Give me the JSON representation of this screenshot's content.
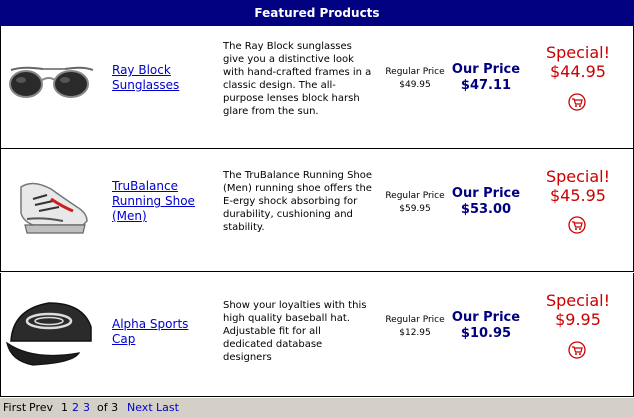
{
  "header": {
    "title": "Featured Products"
  },
  "products": [
    {
      "name": "Ray Block Sunglasses",
      "description": "The Ray Block sunglasses give you a distinctive look with hand-crafted frames in a classic design. The all-purpose lenses block harsh glare from the sun.",
      "regular_label": "Regular Price",
      "regular_price": "$49.95",
      "our_label": "Our Price",
      "our_price": "$47.11",
      "special_label": "Special!",
      "special_price": "$44.95",
      "image_icon": "sunglasses-image",
      "cart_icon": "cart-icon"
    },
    {
      "name": "TruBalance Running Shoe (Men)",
      "description": "The TruBalance Running Shoe (Men) running shoe offers the E-ergy shock absorbing for durability, cushioning and stability.",
      "regular_label": "Regular Price",
      "regular_price": "$59.95",
      "our_label": "Our Price",
      "our_price": "$53.00",
      "special_label": "Special!",
      "special_price": "$45.95",
      "image_icon": "running-shoe-image",
      "cart_icon": "cart-icon"
    },
    {
      "name": "Alpha Sports Cap",
      "description": "Show your loyalties with this high quality baseball hat. Adjustable fit for all dedicated database designers",
      "regular_label": "Regular Price",
      "regular_price": "$12.95",
      "our_label": "Our Price",
      "our_price": "$10.95",
      "special_label": "Special!",
      "special_price": "$9.95",
      "image_icon": "baseball-cap-image",
      "cart_icon": "cart-icon"
    }
  ],
  "pager": {
    "first": "First",
    "prev": "Prev",
    "pages": [
      "1",
      "2",
      "3"
    ],
    "of_text": "of 3",
    "next": "Next",
    "last": "Last"
  },
  "colors": {
    "header_bg": "#000080",
    "our_price": "#000080",
    "special": "#cc0000",
    "link": "#0000cc",
    "pager_bg": "#d4d0c8"
  }
}
